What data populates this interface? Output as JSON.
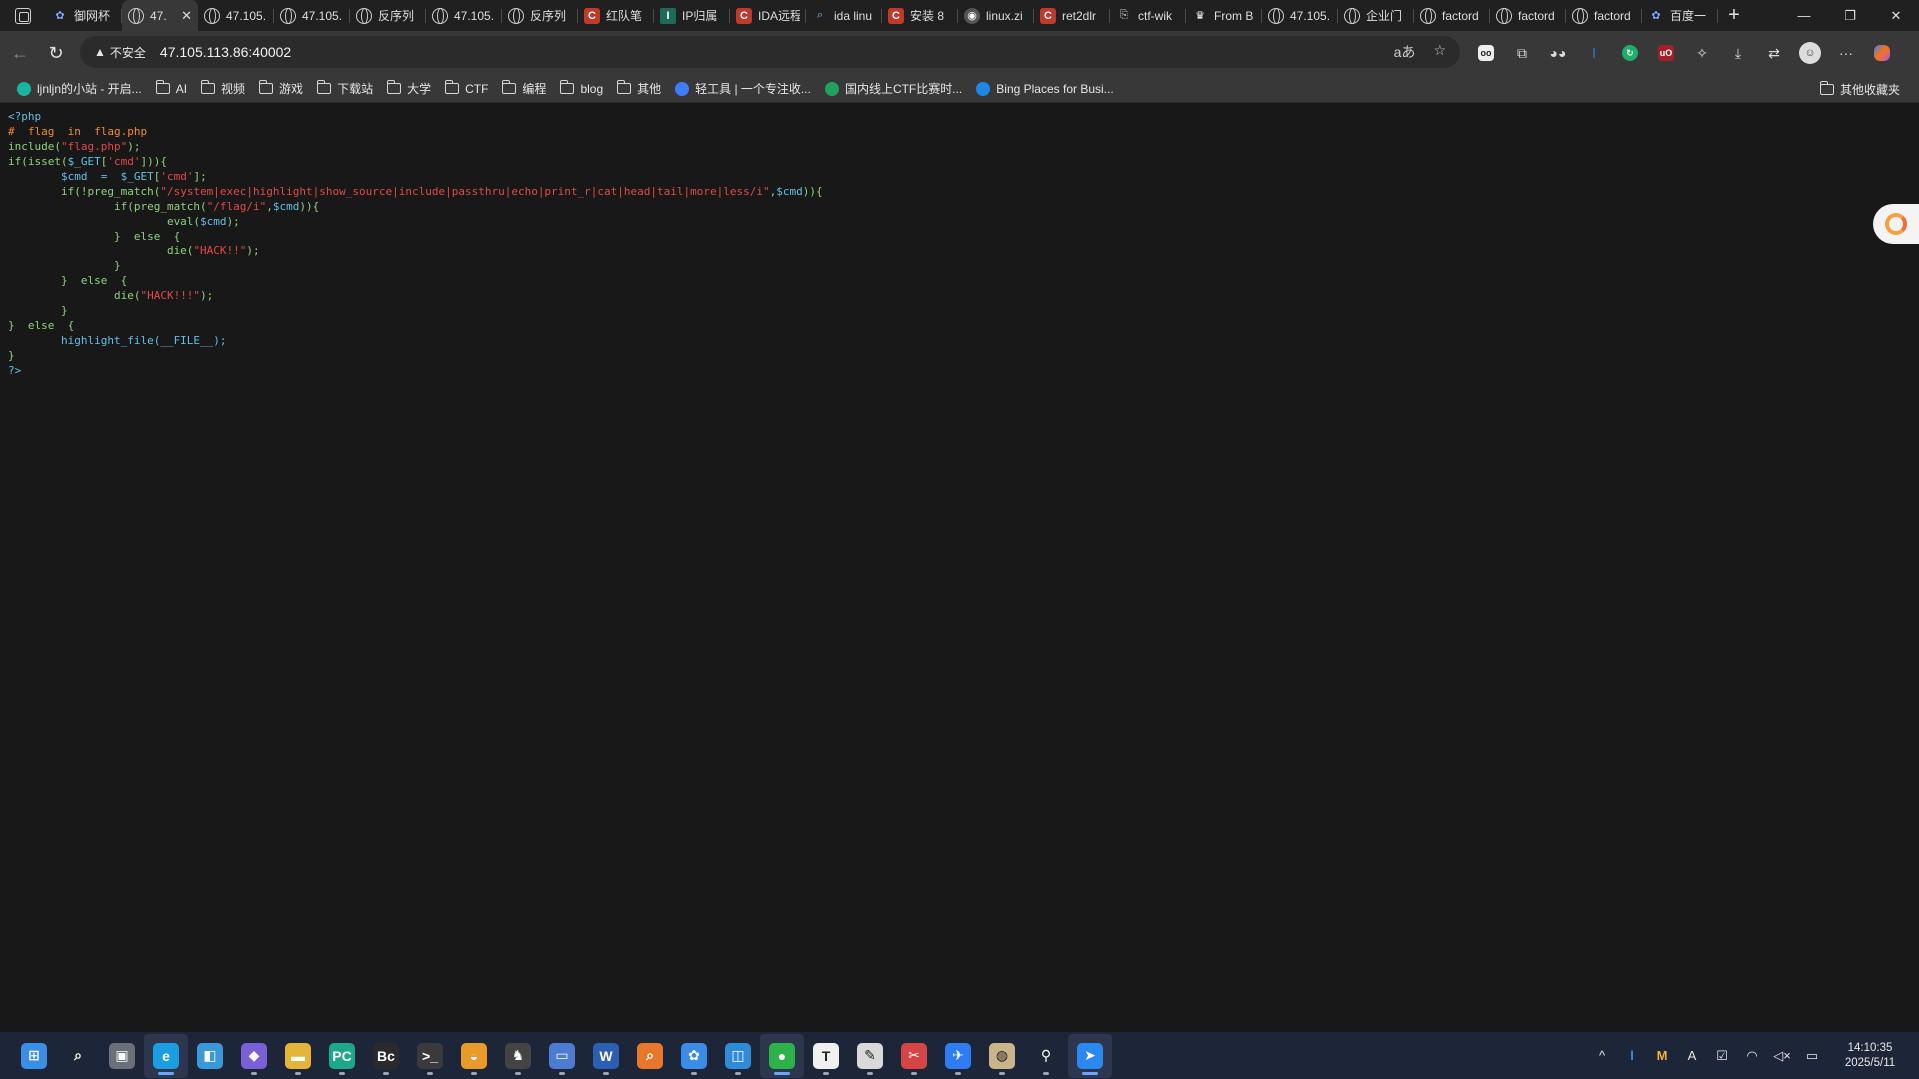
{
  "tabs": [
    {
      "label": "御网杯",
      "icon": "paw-icon",
      "active": false
    },
    {
      "label": "47.",
      "icon": "globe-icon",
      "active": true
    },
    {
      "label": "47.105.",
      "icon": "globe-icon",
      "active": false
    },
    {
      "label": "47.105.",
      "icon": "globe-icon",
      "active": false
    },
    {
      "label": "反序列",
      "icon": "globe-icon",
      "active": false
    },
    {
      "label": "47.105.",
      "icon": "globe-icon",
      "active": false
    },
    {
      "label": "反序列",
      "icon": "globe-icon",
      "active": false
    },
    {
      "label": "红队笔",
      "icon": "csdn-icon",
      "active": false
    },
    {
      "label": "IP归属",
      "icon": "it-icon",
      "active": false
    },
    {
      "label": "IDA远程",
      "icon": "csdn-icon",
      "active": false
    },
    {
      "label": "ida linu",
      "icon": "search-icon",
      "active": false
    },
    {
      "label": "安装 8",
      "icon": "csdn-icon",
      "active": false
    },
    {
      "label": "linux.zi",
      "icon": "github-icon",
      "active": false
    },
    {
      "label": "ret2dlr",
      "icon": "csdn-icon",
      "active": false
    },
    {
      "label": "ctf-wik",
      "icon": "doc-icon",
      "active": false
    },
    {
      "label": "From B",
      "icon": "chef-icon",
      "active": false
    },
    {
      "label": "47.105.",
      "icon": "globe-icon",
      "active": false
    },
    {
      "label": "企业门",
      "icon": "globe-icon",
      "active": false
    },
    {
      "label": "factord",
      "icon": "globe-icon",
      "active": false
    },
    {
      "label": "factord",
      "icon": "globe-icon",
      "active": false
    },
    {
      "label": "factord",
      "icon": "globe-icon",
      "active": false
    },
    {
      "label": "百度一",
      "icon": "baidu-icon",
      "active": false
    }
  ],
  "tab_close_glyph": "✕",
  "new_tab_glyph": "+",
  "window_controls": {
    "minimize": "—",
    "restore": "❐",
    "close": "✕"
  },
  "address_bar": {
    "security_label": "不安全",
    "url": "47.105.113.86:40002"
  },
  "bookmarks": [
    {
      "label": "ljnljn的小站 - 开启...",
      "type": "site",
      "color": "#19b3a0"
    },
    {
      "label": "AI",
      "type": "folder"
    },
    {
      "label": "视频",
      "type": "folder"
    },
    {
      "label": "游戏",
      "type": "folder"
    },
    {
      "label": "下载站",
      "type": "folder"
    },
    {
      "label": "大学",
      "type": "folder"
    },
    {
      "label": "CTF",
      "type": "folder"
    },
    {
      "label": "编程",
      "type": "folder"
    },
    {
      "label": "blog",
      "type": "folder"
    },
    {
      "label": "其他",
      "type": "folder"
    },
    {
      "label": "轻工具 | 一个专注收...",
      "type": "site",
      "color": "#3d7bff"
    },
    {
      "label": "国内线上CTF比赛时...",
      "type": "site",
      "color": "#1fa35b"
    },
    {
      "label": "Bing Places for Busi...",
      "type": "site",
      "color": "#1e88e5"
    }
  ],
  "other_bookmarks": "其他收藏夹",
  "code_lines": [
    [
      {
        "t": "<?php",
        "c": "def"
      }
    ],
    [
      {
        "t": "#  flag  in  flag.php",
        "c": "com"
      }
    ],
    [
      {
        "t": "include(",
        "c": "kw"
      },
      {
        "t": "\"flag.php\"",
        "c": "str"
      },
      {
        "t": ");",
        "c": "kw"
      }
    ],
    [
      {
        "t": "if(isset(",
        "c": "kw"
      },
      {
        "t": "$_GET",
        "c": "var"
      },
      {
        "t": "[",
        "c": "kw"
      },
      {
        "t": "'cmd'",
        "c": "str"
      },
      {
        "t": "])){",
        "c": "kw"
      }
    ],
    [
      {
        "t": "        ",
        "c": "kw"
      },
      {
        "t": "$cmd  =  $_GET",
        "c": "var"
      },
      {
        "t": "[",
        "c": "kw"
      },
      {
        "t": "'cmd'",
        "c": "str"
      },
      {
        "t": "];",
        "c": "kw"
      }
    ],
    [
      {
        "t": "        if(!preg_match(",
        "c": "kw"
      },
      {
        "t": "\"/system|exec|highlight|show_source|include|passthru|echo|print_r|cat|head|tail|more|less/i\"",
        "c": "str"
      },
      {
        "t": ",",
        "c": "kw"
      },
      {
        "t": "$cmd",
        "c": "var"
      },
      {
        "t": ")){",
        "c": "kw"
      }
    ],
    [
      {
        "t": "                if(preg_match(",
        "c": "kw"
      },
      {
        "t": "\"/flag/i\"",
        "c": "str"
      },
      {
        "t": ",",
        "c": "kw"
      },
      {
        "t": "$cmd",
        "c": "var"
      },
      {
        "t": ")){",
        "c": "kw"
      }
    ],
    [
      {
        "t": "                        eval(",
        "c": "kw"
      },
      {
        "t": "$cmd",
        "c": "var"
      },
      {
        "t": ");",
        "c": "kw"
      }
    ],
    [
      {
        "t": "                }  else  {",
        "c": "kw"
      }
    ],
    [
      {
        "t": "                        die(",
        "c": "kw"
      },
      {
        "t": "\"HACK!!\"",
        "c": "str"
      },
      {
        "t": ");",
        "c": "kw"
      }
    ],
    [
      {
        "t": "                }",
        "c": "kw"
      }
    ],
    [
      {
        "t": "        }  else  {",
        "c": "kw"
      }
    ],
    [
      {
        "t": "                die(",
        "c": "kw"
      },
      {
        "t": "\"HACK!!!\"",
        "c": "str"
      },
      {
        "t": ");",
        "c": "kw"
      }
    ],
    [
      {
        "t": "        }",
        "c": "kw"
      }
    ],
    [
      {
        "t": "}  else  {",
        "c": "kw"
      }
    ],
    [
      {
        "t": "        highlight_file(__FILE__);",
        "c": "var"
      }
    ],
    [
      {
        "t": "}",
        "c": "kw"
      }
    ],
    [
      {
        "t": "?>",
        "c": "def"
      }
    ]
  ],
  "taskbar": {
    "apps": [
      {
        "name": "start-icon",
        "glyph": "⊞",
        "color": "#3a8ee6",
        "active": false,
        "running": false
      },
      {
        "name": "search-icon",
        "glyph": "⌕",
        "color": "transparent",
        "active": false,
        "running": false
      },
      {
        "name": "task-view-icon",
        "glyph": "▣",
        "color": "#6b6f78",
        "active": false,
        "running": false
      },
      {
        "name": "edge-icon",
        "glyph": "e",
        "color": "#1b9de2",
        "active": true,
        "running": true
      },
      {
        "name": "store-icon",
        "glyph": "◧",
        "color": "#3a9ad9",
        "active": false,
        "running": false
      },
      {
        "name": "vs-icon",
        "glyph": "◆",
        "color": "#7b5fd6",
        "active": false,
        "running": true
      },
      {
        "name": "explorer-icon",
        "glyph": "▬",
        "color": "#e5b53b",
        "active": false,
        "running": true
      },
      {
        "name": "pycharm-icon",
        "glyph": "PC",
        "color": "#1ea88a",
        "active": false,
        "running": true
      },
      {
        "name": "burp-icon",
        "glyph": "Bc",
        "color": "#2a2a2a",
        "active": false,
        "running": true
      },
      {
        "name": "terminal-icon",
        "glyph": ">_",
        "color": "#3a3a3a",
        "active": false,
        "running": true
      },
      {
        "name": "sublime-icon",
        "glyph": "◒",
        "color": "#e89a2b",
        "active": false,
        "running": true
      },
      {
        "name": "ida-icon",
        "glyph": "♞",
        "color": "#444",
        "active": false,
        "running": true
      },
      {
        "name": "remote-desktop-icon",
        "glyph": "▭",
        "color": "#4c7bd0",
        "active": false,
        "running": true
      },
      {
        "name": "word-icon",
        "glyph": "W",
        "color": "#2b5fb4",
        "active": false,
        "running": true
      },
      {
        "name": "everything-icon",
        "glyph": "⌕",
        "color": "#e8762b",
        "active": false,
        "running": false
      },
      {
        "name": "baidu-netdisk-icon",
        "glyph": "✿",
        "color": "#3b8be8",
        "active": false,
        "running": true
      },
      {
        "name": "vmware-icon",
        "glyph": "◫",
        "color": "#2f8ad8",
        "active": false,
        "running": true
      },
      {
        "name": "wechat-icon",
        "glyph": "●",
        "color": "#2bb34a",
        "active": true,
        "running": true
      },
      {
        "name": "typora-icon",
        "glyph": "T",
        "color": "#f0f0f0",
        "active": false,
        "running": true
      },
      {
        "name": "notepad-icon",
        "glyph": "✎",
        "color": "#d9d9d9",
        "active": false,
        "running": true
      },
      {
        "name": "snipaste-icon",
        "glyph": "✂",
        "color": "#d64545",
        "active": false,
        "running": true
      },
      {
        "name": "feishu-icon",
        "glyph": "✈",
        "color": "#2f7cf6",
        "active": false,
        "running": true
      },
      {
        "name": "dbeaver-icon",
        "glyph": "◍",
        "color": "#c9b48c",
        "active": false,
        "running": true
      },
      {
        "name": "magnifier-icon",
        "glyph": "⚲",
        "color": "transparent",
        "active": false,
        "running": true
      },
      {
        "name": "flow-launcher-icon",
        "glyph": "➤",
        "color": "#2a88f0",
        "active": true,
        "running": true
      }
    ],
    "tray": {
      "chevron": "^",
      "icons": [
        "l",
        "M",
        "A",
        "✔",
        "wifi",
        "vol",
        "bat"
      ],
      "time": "14:10:35",
      "date": "2025/5/11"
    }
  }
}
